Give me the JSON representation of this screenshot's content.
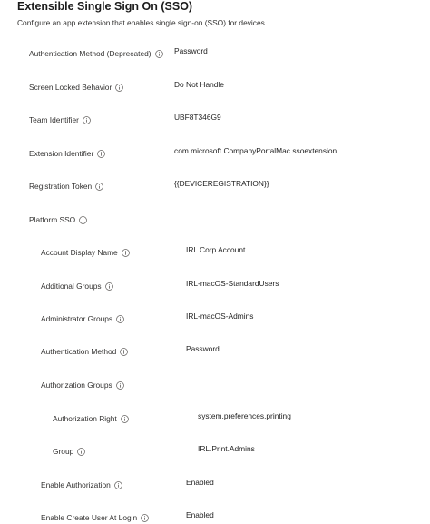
{
  "header": {
    "title": "Extensible Single Sign On (SSO)",
    "subtitle": "Configure an app extension that enables single sign-on (SSO) for devices."
  },
  "settings": [
    {
      "label": "Authentication Method (Deprecated)",
      "value": "Password"
    },
    {
      "label": "Screen Locked Behavior",
      "value": "Do Not Handle"
    },
    {
      "label": "Team Identifier",
      "value": "UBF8T346G9"
    },
    {
      "label": "Extension Identifier",
      "value": "com.microsoft.CompanyPortalMac.ssoextension"
    },
    {
      "label": "Registration Token",
      "value": "{{DEVICEREGISTRATION}}"
    },
    {
      "label": "Platform SSO",
      "value": ""
    },
    {
      "label": "Account Display Name",
      "value": "IRL Corp Account"
    },
    {
      "label": "Additional Groups",
      "value": "IRL-macOS-StandardUsers"
    },
    {
      "label": "Administrator Groups",
      "value": "IRL-macOS-Admins"
    },
    {
      "label": "Authentication Method",
      "value": "Password"
    },
    {
      "label": "Authorization Groups",
      "value": ""
    },
    {
      "label": "Authorization Right",
      "value": "system.preferences.printing"
    },
    {
      "label": "Group",
      "value": "IRL.Print.Admins"
    },
    {
      "label": "Enable Authorization",
      "value": "Enabled"
    },
    {
      "label": "Enable Create User At Login",
      "value": "Enabled"
    }
  ]
}
